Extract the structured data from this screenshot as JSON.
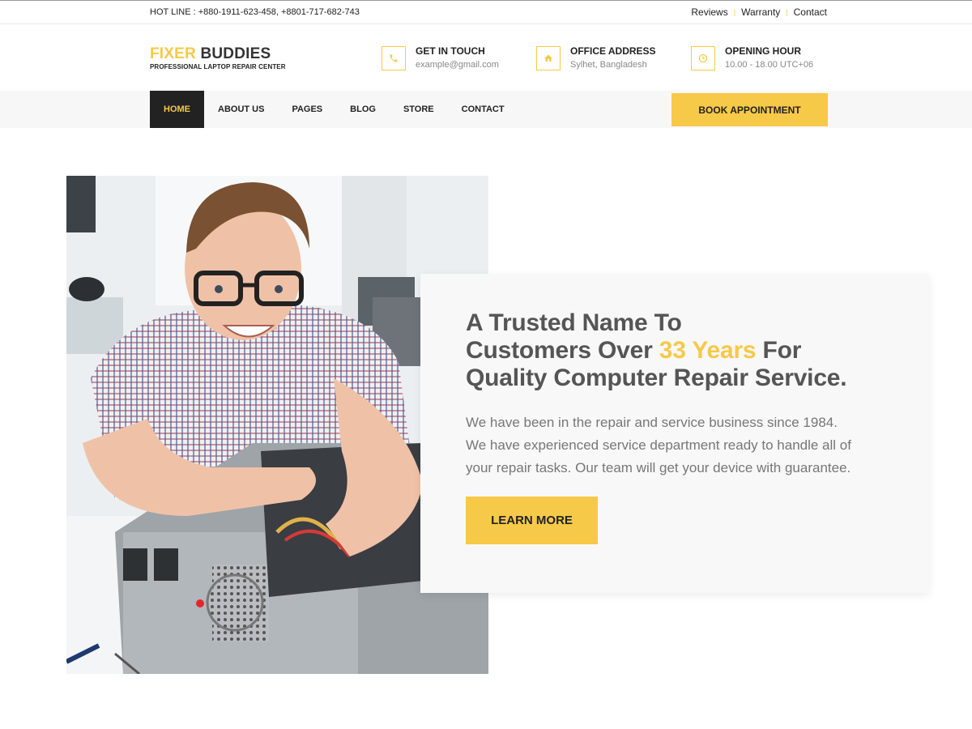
{
  "topbar": {
    "hotline": "HOT LINE : +880-1911-623-458, +8801-717-682-743",
    "links": [
      "Reviews",
      "Warranty",
      "Contact"
    ],
    "separator": "|"
  },
  "logo": {
    "word1": "FIXER",
    "word2": "BUDDIES",
    "tagline": "PROFESSIONAL LAPTOP REPAIR CENTER"
  },
  "header_info": [
    {
      "title": "GET IN TOUCH",
      "subtitle": "example@gmail.com",
      "icon": "phone-icon"
    },
    {
      "title": "OFFICE ADDRESS",
      "subtitle": "Sylhet, Bangladesh",
      "icon": "home-icon"
    },
    {
      "title": "OPENING HOUR",
      "subtitle": "10.00 - 18.00 UTC+06",
      "icon": "clock-icon"
    }
  ],
  "nav": {
    "items": [
      "HOME",
      "ABOUT US",
      "PAGES",
      "BLOG",
      "STORE",
      "CONTACT"
    ],
    "active": "HOME",
    "cta": "BOOK APPOINTMENT"
  },
  "hero": {
    "title_line1": "A Trusted Name To",
    "title_line2_pre": "Customers Over ",
    "title_line2_highlight": "33 Years",
    "title_line2_post": " For",
    "title_line3": "Quality Computer Repair Service.",
    "text_line1": "We have been in the repair and service business since 1984.",
    "text_line2": "We have experienced service department ready to handle all of",
    "text_line3": "your repair tasks. Our team will get your device with guarantee.",
    "button": "LEARN MORE"
  },
  "colors": {
    "accent": "#f7c948",
    "dark": "#222222",
    "nav_bg": "#f7f7f7",
    "card_bg": "#f8f8f8"
  }
}
